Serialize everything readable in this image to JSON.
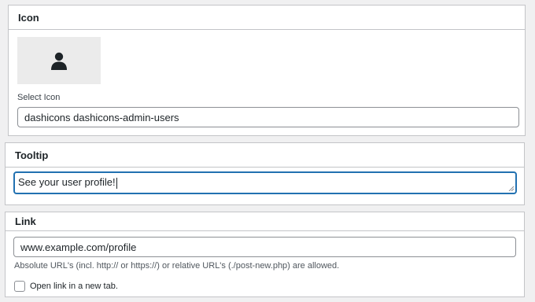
{
  "icon_section": {
    "title": "Icon",
    "preview_icon": "admin-users-icon",
    "select_label": "Select Icon",
    "select_value": "dashicons dashicons-admin-users"
  },
  "tooltip_section": {
    "title": "Tooltip",
    "value": "See your user profile!"
  },
  "link_section": {
    "title": "Link",
    "url_value": "www.example.com/profile",
    "help_text": "Absolute URL's (incl. http:// or https://) or relative URL's (./post-new.php) are allowed.",
    "new_tab_label": "Open link in a new tab.",
    "new_tab_checked": false
  },
  "colors": {
    "focus_border": "#2271b1",
    "panel_border": "#c3c4c7",
    "icon_color": "#1d2327"
  }
}
